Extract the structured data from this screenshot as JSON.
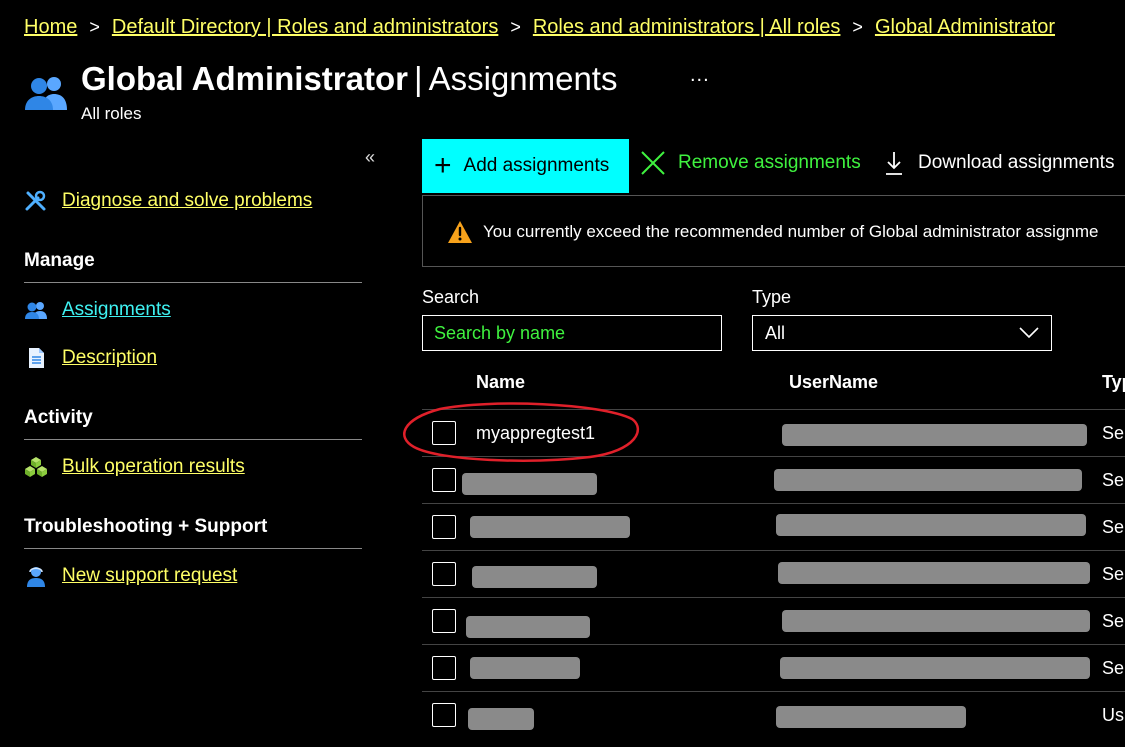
{
  "breadcrumb": {
    "items": [
      "Home",
      "Default Directory | Roles and administrators",
      "Roles and administrators | All roles",
      "Global Administrator"
    ],
    "separator": ">"
  },
  "header": {
    "title_bold": "Global Administrator",
    "title_sep": "|",
    "title_rest": "Assignments",
    "more": "...",
    "subtitle": "All roles"
  },
  "sidebar": {
    "collapse": "«",
    "diagnose": "Diagnose and solve problems",
    "sections": {
      "manage": "Manage",
      "activity": "Activity",
      "troubleshooting": "Troubleshooting + Support"
    },
    "items": {
      "assignments": "Assignments",
      "description": "Description",
      "bulk": "Bulk operation results",
      "support": "New support request"
    }
  },
  "toolbar": {
    "add": "Add assignments",
    "remove": "Remove assignments",
    "download": "Download assignments"
  },
  "banner": {
    "text": "You currently exceed the recommended number of Global administrator assignme"
  },
  "filters": {
    "search_label": "Search",
    "search_placeholder": "Search by name",
    "type_label": "Type",
    "type_value": "All"
  },
  "table": {
    "columns": [
      "Name",
      "UserName",
      "Typ"
    ],
    "rows": [
      {
        "name": "myappregtest1",
        "type": "Ser"
      },
      {
        "name": "",
        "type": "Ser"
      },
      {
        "name": "",
        "type": "Ser"
      },
      {
        "name": "",
        "type": "Ser"
      },
      {
        "name": "",
        "type": "Ser"
      },
      {
        "name": "",
        "type": "Ser"
      },
      {
        "name": "",
        "type": "Us"
      }
    ]
  },
  "colors": {
    "highlight_cyan": "#00ffff",
    "link_yellow": "#ffff66",
    "action_green": "#3ff23f",
    "annotation_red": "#e0202a"
  }
}
